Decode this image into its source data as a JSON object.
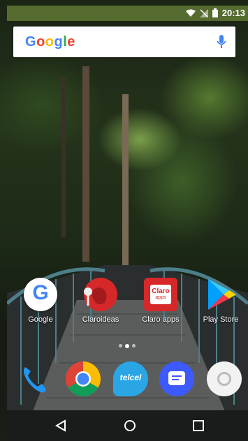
{
  "status": {
    "time": "20:13"
  },
  "search": {
    "logo": "Google",
    "mic_icon": "mic-icon"
  },
  "apps": [
    {
      "label": "Google",
      "icon": "google-icon"
    },
    {
      "label": "Claroideas",
      "icon": "claroideas-icon"
    },
    {
      "label": "Claro apps",
      "icon": "claro-apps-icon",
      "badge_text": "Claro",
      "badge_sub": "apps"
    },
    {
      "label": "Play Store",
      "icon": "play-store-icon"
    }
  ],
  "dock": [
    {
      "name": "phone-icon"
    },
    {
      "name": "chrome-icon"
    },
    {
      "name": "telcel-icon",
      "text": "telcel"
    },
    {
      "name": "messages-icon"
    },
    {
      "name": "camera-icon"
    }
  ],
  "nav": {
    "back": "back-icon",
    "home": "home-icon",
    "recents": "recents-icon"
  },
  "colors": {
    "statusbar": "#556b2f",
    "claro_red": "#d62828",
    "google_blue": "#4285F4"
  }
}
